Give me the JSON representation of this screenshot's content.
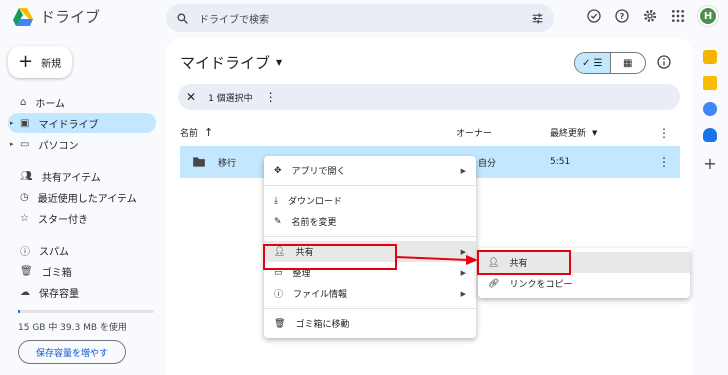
{
  "app": {
    "title": "ドライブ"
  },
  "search": {
    "placeholder": "ドライブで検索"
  },
  "header": {
    "avatar_letter": "H"
  },
  "sidebar": {
    "new_label": "新規",
    "items": [
      {
        "label": "ホーム",
        "icon": "home-icon"
      },
      {
        "label": "マイドライブ",
        "icon": "my-drive-icon",
        "active": true
      },
      {
        "label": "パソコン",
        "icon": "computer-icon"
      },
      {
        "label": "共有アイテム",
        "icon": "people-icon"
      },
      {
        "label": "最近使用したアイテム",
        "icon": "clock-icon"
      },
      {
        "label": "スター付き",
        "icon": "star-icon"
      },
      {
        "label": "スパム",
        "icon": "spam-icon"
      },
      {
        "label": "ゴミ箱",
        "icon": "trash-icon"
      },
      {
        "label": "保存容量",
        "icon": "cloud-icon"
      }
    ],
    "storage_text": "15 GB 中 39.3 MB を使用",
    "storage_fraction": 0.0026,
    "storage_button": "保存容量を増やす"
  },
  "main": {
    "title": "マイドライブ",
    "selection": "1 個選択中",
    "columns": {
      "name": "名前",
      "owner": "オーナー",
      "modified": "最終更新"
    },
    "rows": [
      {
        "name": "移行",
        "owner": "自分",
        "modified": "5:51"
      }
    ]
  },
  "context_menu": {
    "items": [
      {
        "label": "アプリで開く",
        "icon": "open-with-icon",
        "submenu": true
      },
      {
        "label": "ダウンロード",
        "icon": "download-icon"
      },
      {
        "label": "名前を変更",
        "icon": "rename-icon"
      },
      {
        "label": "共有",
        "icon": "share-icon",
        "submenu": true
      },
      {
        "label": "整理",
        "icon": "folder-icon",
        "submenu": true
      },
      {
        "label": "ファイル情報",
        "icon": "info-icon",
        "submenu": true
      },
      {
        "label": "ゴミ箱に移動",
        "icon": "trash-icon"
      }
    ]
  },
  "share_submenu": {
    "items": [
      {
        "label": "共有",
        "icon": "share-icon"
      },
      {
        "label": "リンクをコピー",
        "icon": "link-icon"
      }
    ]
  },
  "colors": {
    "accent": "#c2e7ff",
    "highlight": "#e60012",
    "avatar": "#4e8f4e"
  }
}
